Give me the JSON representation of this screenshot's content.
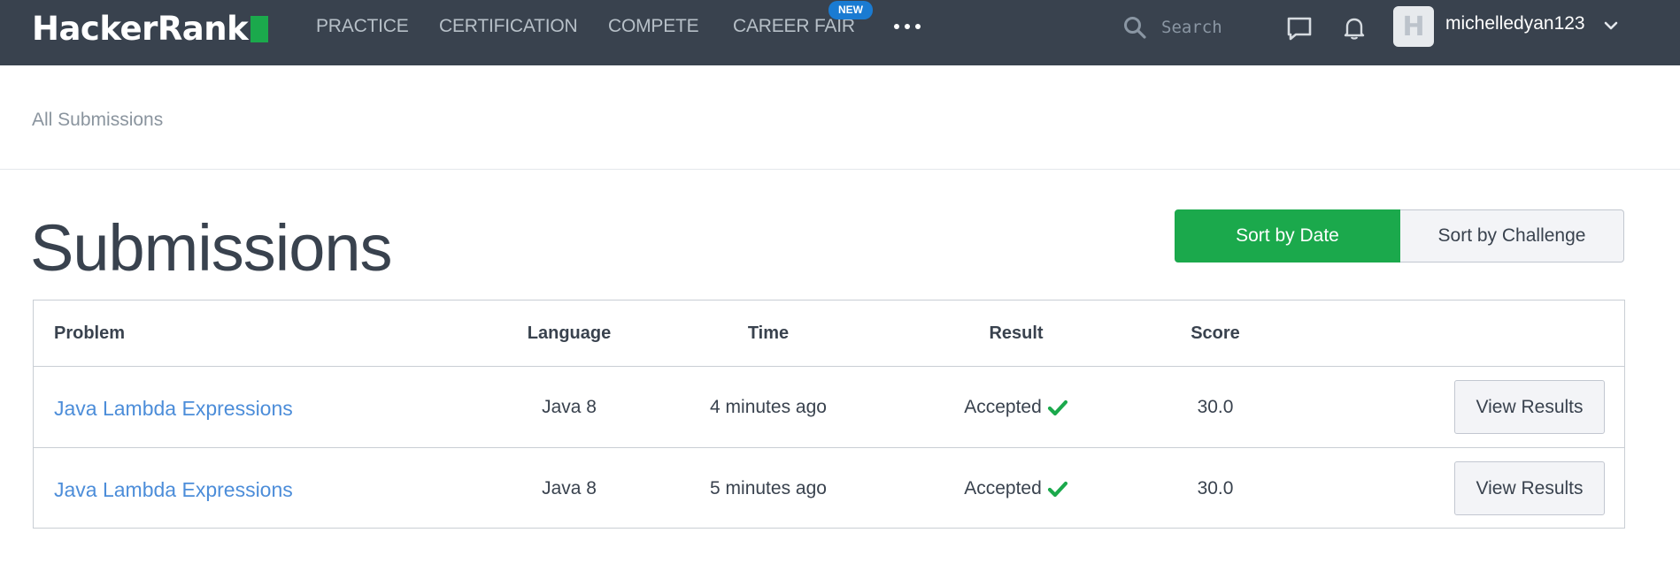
{
  "nav": {
    "logo_text": "HackerRank",
    "items": [
      {
        "label": "PRACTICE"
      },
      {
        "label": "CERTIFICATION"
      },
      {
        "label": "COMPETE"
      },
      {
        "label": "CAREER FAIR",
        "badge": "NEW"
      }
    ],
    "more_icon": "ellipsis-icon",
    "search": {
      "placeholder": "Search",
      "icon": "search-icon"
    },
    "messages_icon": "chat-bubble-icon",
    "notifications_icon": "bell-icon",
    "avatar_letter": "H",
    "username": "michelledyan123",
    "user_menu_icon": "chevron-down-icon",
    "colors": {
      "bar": "#39424e",
      "badge": "#1a7bd2",
      "logo_block": "#1ba94c"
    }
  },
  "breadcrumb": {
    "label": "All Submissions"
  },
  "page": {
    "title": "Submissions"
  },
  "sort": {
    "by_date_label": "Sort by Date",
    "by_challenge_label": "Sort by Challenge",
    "active": "Sort by Date",
    "colors": {
      "active": "#1ba94c"
    }
  },
  "table": {
    "headers": {
      "problem": "Problem",
      "language": "Language",
      "time": "Time",
      "result": "Result",
      "score": "Score"
    },
    "rows": [
      {
        "problem": "Java Lambda Expressions",
        "language": "Java 8",
        "time": "4 minutes ago",
        "result": "Accepted",
        "result_icon": "check-icon",
        "score": "30.0",
        "action_label": "View Results"
      },
      {
        "problem": "Java Lambda Expressions",
        "language": "Java 8",
        "time": "5 minutes ago",
        "result": "Accepted",
        "result_icon": "check-icon",
        "score": "30.0",
        "action_label": "View Results"
      }
    ],
    "colors": {
      "link": "#4c8dd9",
      "accepted": "#1ba94c"
    }
  }
}
